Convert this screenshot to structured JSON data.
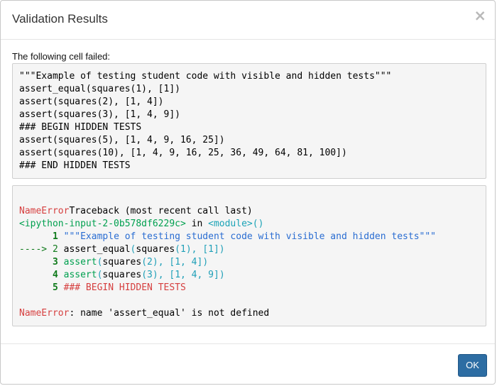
{
  "modal": {
    "title": "Validation Results",
    "close_glyph": "×",
    "ok_label": "OK"
  },
  "cell": {
    "label": "The following cell failed:",
    "source_lines": [
      "\"\"\"Example of testing student code with visible and hidden tests\"\"\"",
      "assert_equal(squares(1), [1])",
      "assert(squares(2), [1, 4])",
      "assert(squares(3), [1, 4, 9])",
      "### BEGIN HIDDEN TESTS",
      "assert(squares(5), [1, 4, 9, 16, 25])",
      "assert(squares(10), [1, 4, 9, 16, 25, 36, 49, 64, 81, 100])",
      "### END HIDDEN TESTS"
    ]
  },
  "traceback": {
    "error_name": "NameError",
    "header_rest": "Traceback (most recent call last)",
    "input_ref": "<ipython-input-2-0b578df6229c>",
    "in_word": " in ",
    "module": "<module>()",
    "frames": [
      {
        "marker": "      1 ",
        "code": "\"\"\"Example of testing student code with visible and hidden tests\"\"\""
      },
      {
        "marker": "----> 2 ",
        "code": "assert_equal(squares(1), [1])"
      },
      {
        "marker": "      3 ",
        "code": "assert(squares(2), [1, 4])"
      },
      {
        "marker": "      4 ",
        "code": "assert(squares(3), [1, 4, 9])"
      },
      {
        "marker": "      5 ",
        "code": "### BEGIN HIDDEN TESTS"
      }
    ],
    "final_error_name": "NameError",
    "final_message": ": name 'assert_equal' is not defined"
  },
  "colors": {
    "error_red": "#d63f3f",
    "input_green": "#00a04f",
    "module_teal": "#1aa3b6",
    "docstring_blue": "#2a6dd2",
    "line_number_green": "#0f7a1b",
    "ok_button_blue": "#2d6da3"
  }
}
